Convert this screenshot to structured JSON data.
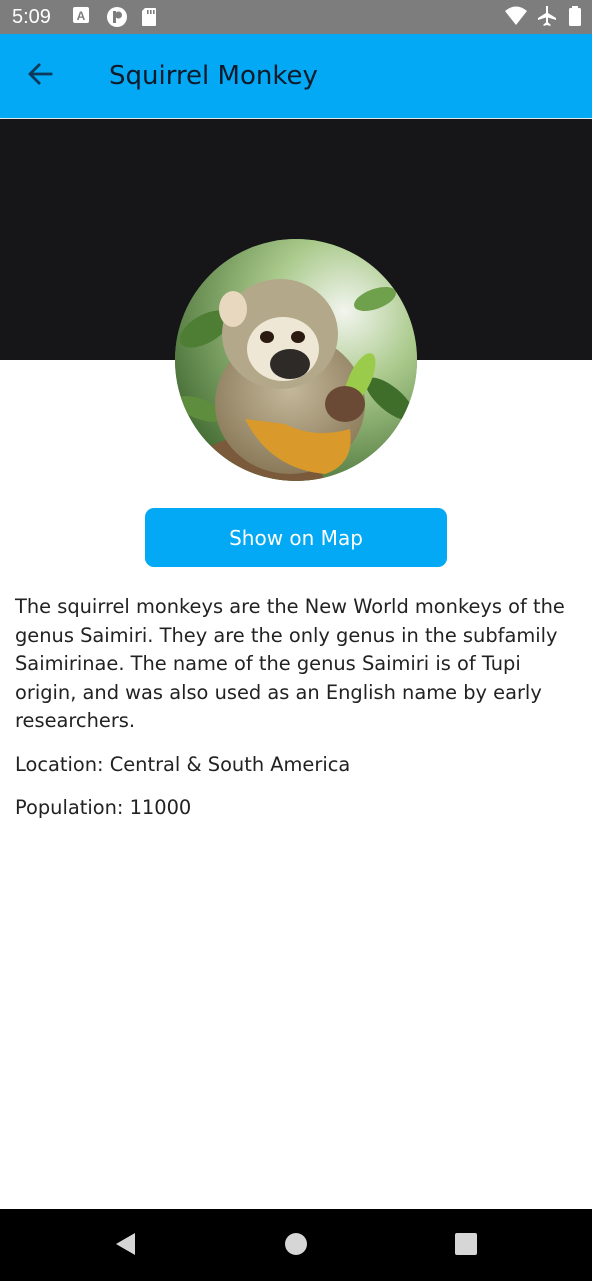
{
  "status_bar": {
    "time": "5:09",
    "left_icons": [
      "keyboard-a-icon",
      "accessibility-p-icon",
      "sd-card-icon"
    ],
    "right_icons": [
      "wifi-icon",
      "airplane-icon",
      "battery-icon"
    ]
  },
  "app_bar": {
    "title": "Squirrel Monkey",
    "back_icon": "arrow-back-icon"
  },
  "colors": {
    "accent": "#03a9f4",
    "status_bar": "#7d7d7d",
    "hero_band": "#161618",
    "nav_bar": "#000000",
    "text": "#222222"
  },
  "animal": {
    "image_alt": "squirrel monkey photo",
    "button_label": "Show on Map",
    "description": "The squirrel monkeys are the New World monkeys of the genus Saimiri. They are the only genus in the subfamily Saimirinae. The name of the genus Saimiri is of Tupi origin, and was also used as an English name by early researchers.",
    "location": "Location: Central & South America",
    "population": "Population: 11000"
  },
  "nav_bar": {
    "buttons": [
      "back-triangle-icon",
      "home-circle-icon",
      "recents-square-icon"
    ]
  }
}
